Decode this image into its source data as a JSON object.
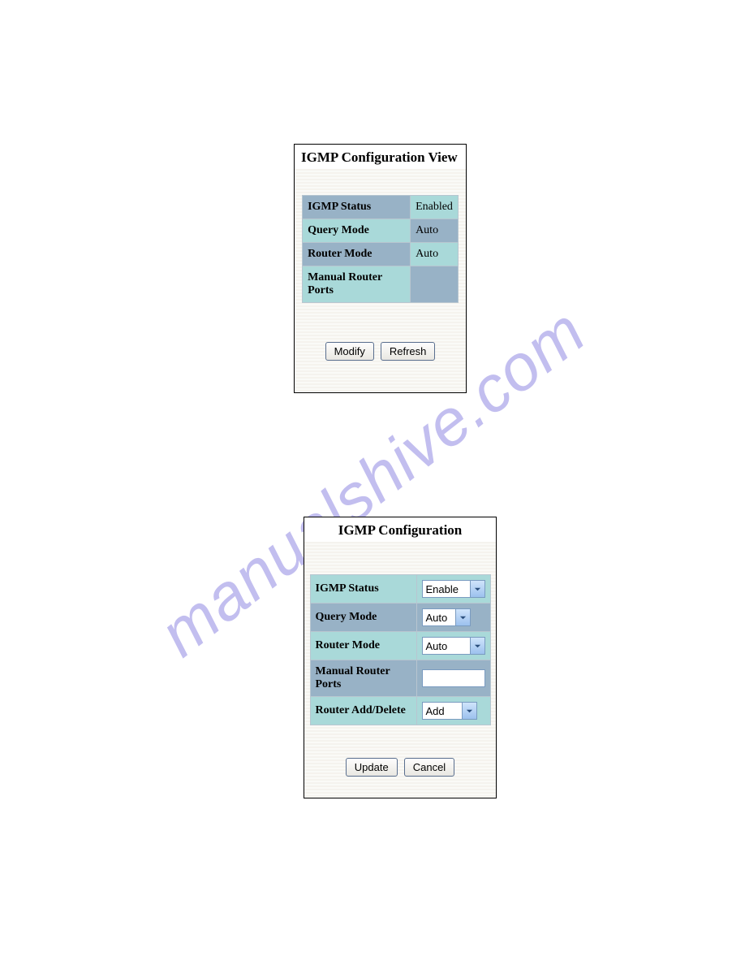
{
  "watermark": "manualshive.com",
  "panel1": {
    "title": "IGMP Configuration View",
    "rows": {
      "r1": {
        "label": "IGMP Status",
        "value": "Enabled"
      },
      "r2": {
        "label": "Query Mode",
        "value": "Auto"
      },
      "r3": {
        "label": "Router Mode",
        "value": "Auto"
      },
      "r4": {
        "label": "Manual Router Ports",
        "value": ""
      }
    },
    "buttons": {
      "modify": "Modify",
      "refresh": "Refresh"
    }
  },
  "panel2": {
    "title": "IGMP Configuration",
    "rows": {
      "r1": {
        "label": "IGMP Status",
        "value": "Enable"
      },
      "r2": {
        "label": "Query Mode",
        "value": "Auto"
      },
      "r3": {
        "label": "Router Mode",
        "value": "Auto"
      },
      "r4": {
        "label": "Manual Router Ports",
        "value": ""
      },
      "r5": {
        "label": "Router Add/Delete",
        "value": "Add"
      }
    },
    "buttons": {
      "update": "Update",
      "cancel": "Cancel"
    }
  }
}
